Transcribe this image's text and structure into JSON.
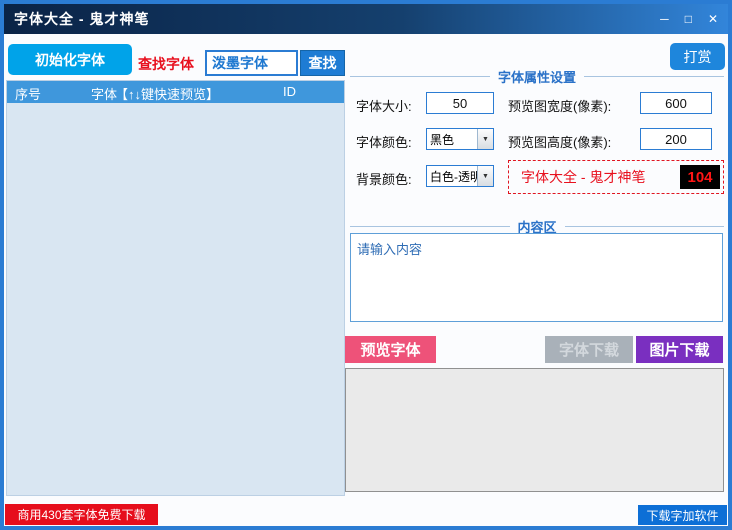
{
  "window": {
    "title": "字体大全 - 鬼才神笔"
  },
  "window_controls": {
    "minimize": "─",
    "maximize": "□",
    "close": "✕"
  },
  "toolbar": {
    "init_button": "初始化字体",
    "search_label": "查找字体",
    "search_value": "泼墨字体",
    "search_button": "查找",
    "reward_button": "打赏"
  },
  "font_list": {
    "col_index": "序号",
    "col_font": "字体",
    "col_hint": "【↑↓键快速预览】",
    "col_id": "ID",
    "rows": []
  },
  "properties": {
    "section_title": "字体属性设置",
    "font_size_label": "字体大小:",
    "font_size_value": "50",
    "preview_width_label": "预览图宽度(像素):",
    "preview_width_value": "600",
    "font_color_label": "字体颜色:",
    "font_color_value": "黑色",
    "preview_height_label": "预览图高度(像素):",
    "preview_height_value": "200",
    "bg_color_label": "背景颜色:",
    "bg_color_value": "白色-透明",
    "dropdown_arrow": "▼",
    "brand_text": "字体大全 - 鬼才神笔",
    "counter_value": "104"
  },
  "content": {
    "section_title": "内容区",
    "placeholder": "请输入内容"
  },
  "actions": {
    "preview_font": "预览字体",
    "font_download": "字体下载",
    "image_download": "图片下载"
  },
  "footer": {
    "free_download": "商用430套字体免费下载",
    "zijia_download": "下载字加软件"
  },
  "colors": {
    "titlebar_dark": "#0a2346",
    "titlebar_light": "#3285da",
    "accent_blue": "#2b7cd3",
    "bright_blue": "#00a3e9",
    "list_header_blue": "#3f97dc",
    "list_body_blue": "#d9e6f2",
    "alert_red": "#e8101e",
    "pink": "#ee5279",
    "purple": "#7a2fc0",
    "disabled_grey": "#a9b1b9"
  }
}
